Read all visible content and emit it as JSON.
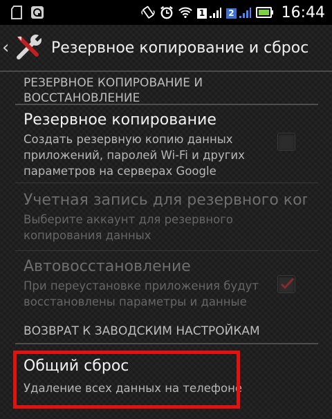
{
  "status_bar": {
    "time": "16:44",
    "sim1": "1",
    "sim2": "2",
    "icons": [
      "sd-card-icon",
      "app-notification-icon",
      "vibrate-icon",
      "alarm-icon",
      "wifi-icon",
      "signal-icon",
      "battery-icon"
    ]
  },
  "action_bar": {
    "title": "Резервное копирование и сброс"
  },
  "sections": {
    "backup_header_line1": "РЕЗЕРВНОЕ КОПИРОВАНИЕ И",
    "backup_header_line2": "ВОССТАНОВЛЕНИЕ",
    "reset_header": "ВОЗВРАТ К ЗАВОДСКИМ НАСТРОЙКАМ"
  },
  "items": {
    "backup": {
      "title": "Резервное копирование",
      "summary_line1": "Создать резервную копию данных",
      "summary_line2": "приложений, паролей Wi-Fi и других",
      "summary_line3": "параметров на серверах Google",
      "checked": false
    },
    "account": {
      "title": "Учетная запись для резервного копи",
      "summary_line1": "Выберите аккаунт для резервного",
      "summary_line2": "копирования данных"
    },
    "auto_restore": {
      "title": "Автовосстановление",
      "summary_line1": "При переустановке приложения будут",
      "summary_line2": "восстановлены параметры и данные",
      "checked": true
    },
    "factory_reset": {
      "title": "Общий сброс",
      "summary": "Удаление всех данных на телефоне"
    }
  },
  "colors": {
    "highlight": "#e41111",
    "check": "#8a2a2a",
    "background": "#1d1d1d"
  }
}
